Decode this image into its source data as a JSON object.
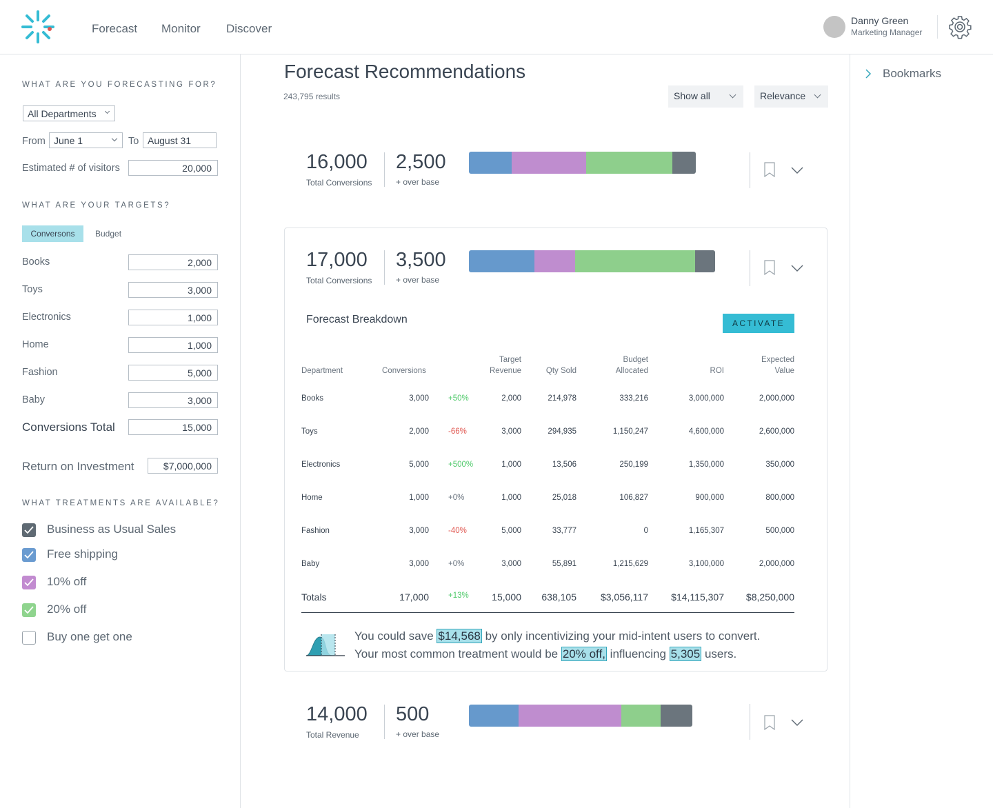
{
  "nav": {
    "items": [
      "Forecast",
      "Monitor",
      "Discover"
    ]
  },
  "user": {
    "name": "Danny Green",
    "role": "Marketing Manager"
  },
  "sidebar": {
    "forecasting_label": "WHAT ARE YOU FORECASTING FOR?",
    "department_select": "All Departments",
    "from_label": "From",
    "from_value": "June 1",
    "to_label": "To",
    "to_value": "August 31",
    "visitors_label": "Estimated # of visitors",
    "visitors_value": "20,000",
    "targets_label": "WHAT ARE YOUR TARGETS?",
    "target_tabs": [
      "Conversons",
      "Budget"
    ],
    "targets": [
      {
        "label": "Books",
        "value": "2,000"
      },
      {
        "label": "Toys",
        "value": "3,000"
      },
      {
        "label": "Electronics",
        "value": "1,000"
      },
      {
        "label": "Home",
        "value": "1,000"
      },
      {
        "label": "Fashion",
        "value": "5,000"
      },
      {
        "label": "Baby",
        "value": "3,000"
      }
    ],
    "conversions_total_label": "Conversions Total",
    "conversions_total_value": "15,000",
    "roi_label": "Return on Investment",
    "roi_value": "$7,000,000",
    "treatments_label": "WHAT TREATMENTS ARE AVAILABLE?",
    "treatments": [
      {
        "label": "Business as Usual Sales",
        "checked": true,
        "color": "#5f6a73"
      },
      {
        "label": "Free shipping",
        "checked": true,
        "color": "#6a9bd0"
      },
      {
        "label": "10% off",
        "checked": true,
        "color": "#c28bd0"
      },
      {
        "label": "20% off",
        "checked": true,
        "color": "#8fd48e"
      },
      {
        "label": "Buy one get one",
        "checked": false,
        "color": "#9aa3ab"
      }
    ]
  },
  "main": {
    "title": "Forecast Recommendations",
    "results": "243,795 results",
    "filter_show": "Show all",
    "filter_sort": "Relevance",
    "colors": {
      "free_shipping": "#6699cc",
      "ten_off": "#bf8dcf",
      "twenty_off": "#8ecf8c",
      "bau": "#6b757d"
    },
    "cards": [
      {
        "total": "16,000",
        "total_label": "Total Conversions",
        "over": "2,500",
        "over_label": "+ over base",
        "segments": [
          62,
          108,
          125,
          34
        ]
      },
      {
        "total": "17,000",
        "total_label": "Total Conversions",
        "over": "3,500",
        "over_label": "+ over base",
        "segments": [
          95,
          59,
          174,
          29
        ]
      },
      {
        "total": "14,000",
        "total_label": "Total Revenue",
        "over": "500",
        "over_label": "+ over base",
        "segments": [
          72,
          149,
          57,
          46
        ]
      }
    ],
    "breakdown": {
      "title": "Forecast Breakdown",
      "activate": "ACTIVATE",
      "headers": [
        "Department",
        "Conversions",
        "Target\nRevenue",
        "Qty Sold",
        "Budget\nAllocated",
        "ROI",
        "Expected\nValue"
      ],
      "rows": [
        {
          "dept": "Books",
          "conv": "3,000",
          "delta": "+50%",
          "trend": "pos",
          "target": "2,000",
          "qty": "214,978",
          "budget": "333,216",
          "roi": "3,000,000",
          "ev": "2,000,000"
        },
        {
          "dept": "Toys",
          "conv": "2,000",
          "delta": "-66%",
          "trend": "neg",
          "target": "3,000",
          "qty": "294,935",
          "budget": "1,150,247",
          "roi": "4,600,000",
          "ev": "2,600,000"
        },
        {
          "dept": "Electronics",
          "conv": "5,000",
          "delta": "+500%",
          "trend": "pos",
          "target": "1,000",
          "qty": "13,506",
          "budget": "250,199",
          "roi": "1,350,000",
          "ev": "350,000"
        },
        {
          "dept": "Home",
          "conv": "1,000",
          "delta": "+0%",
          "trend": "neu",
          "target": "1,000",
          "qty": "25,018",
          "budget": "106,827",
          "roi": "900,000",
          "ev": "800,000"
        },
        {
          "dept": "Fashion",
          "conv": "3,000",
          "delta": "-40%",
          "trend": "neg",
          "target": "5,000",
          "qty": "33,777",
          "budget": "0",
          "roi": "1,165,307",
          "ev": "500,000"
        },
        {
          "dept": "Baby",
          "conv": "3,000",
          "delta": "+0%",
          "trend": "neu",
          "target": "3,000",
          "qty": "55,891",
          "budget": "1,215,629",
          "roi": "3,100,000",
          "ev": "2,000,000"
        }
      ],
      "totals": {
        "dept": "Totals",
        "conv": "17,000",
        "delta": "+13%",
        "trend": "pos",
        "target": "15,000",
        "qty": "638,105",
        "budget": "$3,056,117",
        "roi": "$14,115,307",
        "ev": "$8,250,000"
      },
      "insight": {
        "l1_a": "You could save ",
        "l1_hl": "$14,568",
        "l1_b": " by only incentivizing your mid-intent users to convert.",
        "l2_a": "Your most common treatment would be ",
        "l2_hl1": "20% off,",
        "l2_b": " influencing ",
        "l2_hl2": "5,305",
        "l2_c": " users."
      }
    }
  },
  "bookmarks": {
    "label": "Bookmarks"
  }
}
